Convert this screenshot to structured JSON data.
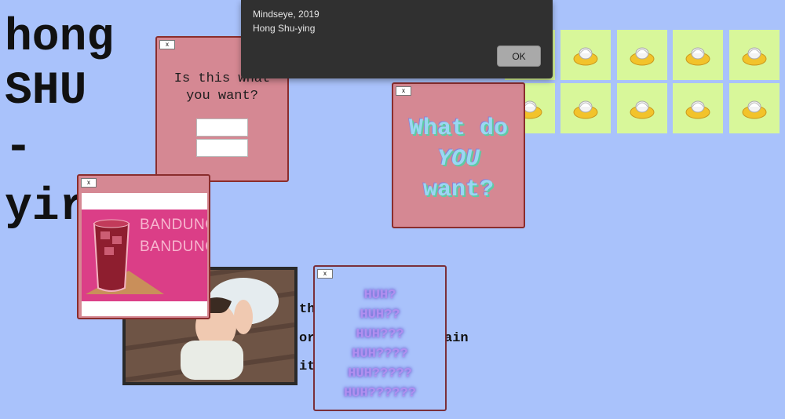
{
  "title": {
    "lines": [
      "hong",
      "SHU",
      "-",
      "yir"
    ]
  },
  "background_text": {
    "line1": "th",
    "line2": "or",
    "line2_end": "ain",
    "line3": "it"
  },
  "tiles": {
    "count": 10,
    "color": "#d8f79a",
    "icon": "nest-icon"
  },
  "popups": {
    "question": {
      "close_label": "x",
      "line1": "Is this what",
      "line2": "you want?"
    },
    "product": {
      "close_label": "x",
      "brand_line1": "BANDUNG",
      "brand_line2": "BANDUNG"
    },
    "want": {
      "close_label": "x",
      "line1": "What do",
      "line2": "YOU",
      "line3": "want?"
    },
    "huh": {
      "close_label": "x",
      "lines": [
        "HUH?",
        "HUH??",
        "HUH???",
        "HUH????",
        "HUH?????",
        "HUH??????"
      ]
    }
  },
  "dialog": {
    "line1": "Mindseye, 2019",
    "line2": "Hong Shu-ying",
    "ok_label": "OK"
  },
  "colors": {
    "background": "#a9c2fb",
    "popup_pink": "#d58893",
    "product_magenta": "#db3e87",
    "border": "#8a2d2d"
  }
}
